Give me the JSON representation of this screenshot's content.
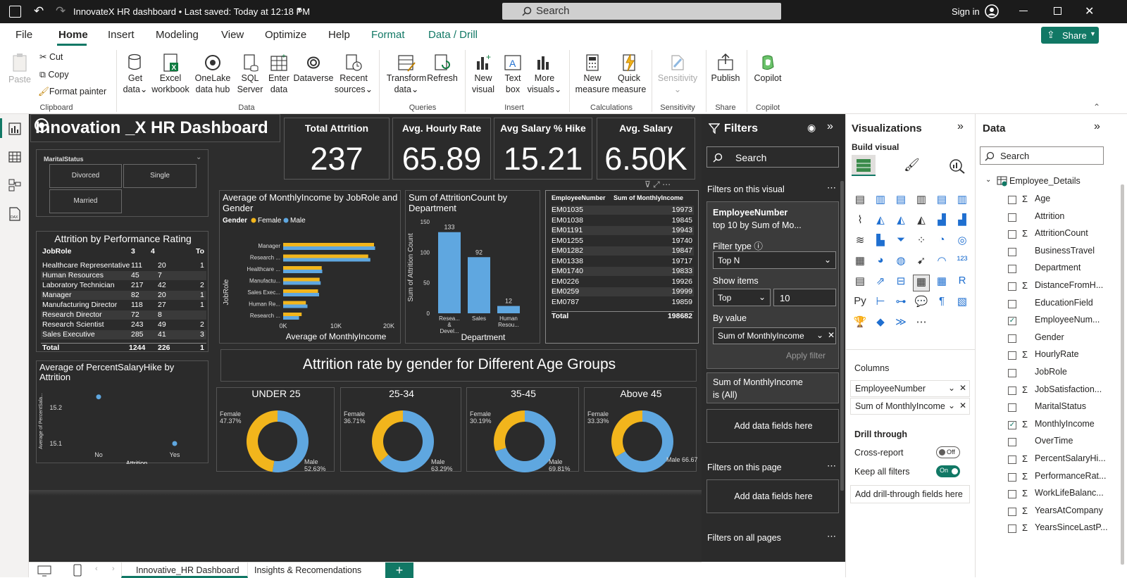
{
  "titlebar": {
    "file_title": "InnovateX HR dashboard • Last saved: Today at 12:18 PM",
    "search": "Search",
    "signin": "Sign in"
  },
  "tabs": [
    "File",
    "Home",
    "Insert",
    "Modeling",
    "View",
    "Optimize",
    "Help",
    "Format",
    "Data / Drill"
  ],
  "share": "Share",
  "ribbon": {
    "clipboard": {
      "paste": "Paste",
      "cut": "Cut",
      "copy": "Copy",
      "format_painter": "Format painter",
      "group": "Clipboard"
    },
    "data": {
      "get_data_1": "Get",
      "get_data_2": "data",
      "excel_1": "Excel",
      "excel_2": "workbook",
      "onelake_1": "OneLake",
      "onelake_2": "data hub",
      "sql_1": "SQL",
      "sql_2": "Server",
      "enter_1": "Enter",
      "enter_2": "data",
      "dataverse": "Dataverse",
      "recent_1": "Recent",
      "recent_2": "sources",
      "group": "Data"
    },
    "queries": {
      "transform_1": "Transform",
      "transform_2": "data",
      "refresh": "Refresh",
      "group": "Queries"
    },
    "insert": {
      "new_visual_1": "New",
      "new_visual_2": "visual",
      "textbox_1": "Text",
      "textbox_2": "box",
      "more_1": "More",
      "more_2": "visuals",
      "group": "Insert"
    },
    "calculations": {
      "newm_1": "New",
      "newm_2": "measure",
      "quick_1": "Quick",
      "quick_2": "measure",
      "group": "Calculations"
    },
    "sensitivity": {
      "label": "Sensitivity",
      "group": "Sensitivity"
    },
    "share_grp": {
      "publish": "Publish",
      "group": "Share"
    },
    "copilot_grp": {
      "copilot": "Copilot",
      "group": "Copilot"
    }
  },
  "dashboard": {
    "title": "Innovation _X HR Dashboard",
    "kpis": [
      {
        "title": "Total Attrition",
        "value": "237"
      },
      {
        "title": "Avg. Hourly Rate",
        "value": "65.89"
      },
      {
        "title": "Avg Salary % Hike",
        "value": "15.21"
      },
      {
        "title": "Avg. Salary",
        "value": "6.50K"
      }
    ],
    "slicer": {
      "title": "MaritalStatus",
      "options": [
        "Divorced",
        "Single",
        "Married"
      ]
    },
    "perf_table": {
      "title": "Attrition by Performance Rating",
      "headers": [
        "JobRole",
        "3",
        "4",
        "To"
      ],
      "rows": [
        [
          "Healthcare Representative",
          "111",
          "20",
          "1"
        ],
        [
          "Human Resources",
          "45",
          "7",
          ""
        ],
        [
          "Laboratory Technician",
          "217",
          "42",
          "2"
        ],
        [
          "Manager",
          "82",
          "20",
          "1"
        ],
        [
          "Manufacturing Director",
          "118",
          "27",
          "1"
        ],
        [
          "Research Director",
          "72",
          "8",
          ""
        ],
        [
          "Research Scientist",
          "243",
          "49",
          "2"
        ],
        [
          "Sales Executive",
          "285",
          "41",
          "3"
        ]
      ],
      "total": [
        "Total",
        "1244",
        "226",
        "1"
      ]
    },
    "section_title": "Attrition rate by gender for Different Age Groups",
    "donuts": [
      {
        "title": "UNDER 25",
        "female_label": "Female",
        "female_pct": "47.37%",
        "male_label": "Male",
        "male_pct": "52.63%",
        "female": 47.37
      },
      {
        "title": "25-34",
        "female_label": "Female",
        "female_pct": "36.71%",
        "male_label": "Male",
        "male_pct": "63.29%",
        "female": 36.71
      },
      {
        "title": "35-45",
        "female_label": "Female",
        "female_pct": "30.19%",
        "male_label": "Male",
        "male_pct": "69.81%",
        "female": 30.19
      },
      {
        "title": "Above 45",
        "female_label": "Female",
        "female_pct": "33.33%",
        "male_label": "Male",
        "male_pct": "66.67%",
        "female": 33.33
      }
    ],
    "emp_table": {
      "headers": [
        "EmployeeNumber",
        "Sum of MonthlyIncome"
      ],
      "rows": [
        [
          "EM01035",
          "19973"
        ],
        [
          "EM01038",
          "19845"
        ],
        [
          "EM01191",
          "19943"
        ],
        [
          "EM01255",
          "19740"
        ],
        [
          "EM01282",
          "19847"
        ],
        [
          "EM01338",
          "19717"
        ],
        [
          "EM01740",
          "19833"
        ],
        [
          "EM0226",
          "19926"
        ],
        [
          "EM0259",
          "19999"
        ],
        [
          "EM0787",
          "19859"
        ]
      ],
      "total": [
        "Total",
        "198682"
      ]
    }
  },
  "chart_data": [
    {
      "type": "bar",
      "title": "Average of MonthlyIncome by JobRole and Gender",
      "legend_title": "Gender",
      "xlabel": "Average of MonthlyIncome",
      "ylabel": "JobRole",
      "xticks": [
        "0K",
        "10K",
        "20K"
      ],
      "xlim": [
        0,
        20000
      ],
      "categories": [
        "Manager",
        "Research ...",
        "Healthcare ...",
        "Manufactu...",
        "Sales Exec...",
        "Human Re...",
        "Research ..."
      ],
      "series": [
        {
          "name": "Female",
          "color": "#F2B51C",
          "values": [
            17200,
            16100,
            7300,
            6900,
            6600,
            4300,
            3500
          ]
        },
        {
          "name": "Male",
          "color": "#5FA7E0",
          "values": [
            17400,
            16500,
            7400,
            7100,
            6800,
            4600,
            3000
          ]
        }
      ]
    },
    {
      "type": "bar",
      "title": "Sum of AttritionCount by Department",
      "xlabel": "Department",
      "ylabel": "Sum of Attrition Count",
      "ylim": [
        0,
        150
      ],
      "yticks": [
        "150",
        "100",
        "50",
        "0"
      ],
      "categories": [
        "Resea...\n&\nDevel...",
        "Sales",
        "Human\nResou..."
      ],
      "values": [
        133,
        92,
        12
      ],
      "color": "#5FA7E0"
    },
    {
      "type": "scatter",
      "title": "Average of PercentSalaryHike by Attrition",
      "xlabel": "Attrition",
      "ylabel": "Average of PercentSala...",
      "yticks": [
        "15.2",
        "15.1"
      ],
      "categories": [
        "No",
        "Yes"
      ],
      "values": [
        15.23,
        15.1
      ],
      "color": "#5FA7E0"
    }
  ],
  "filters": {
    "title": "Filters",
    "search": "Search",
    "on_visual": "Filters on this visual",
    "card1": {
      "field": "EmployeeNumber",
      "desc": "top 10 by Sum of Mo...",
      "filter_type_label": "Filter type",
      "filter_type": "Top N",
      "show_items_label": "Show items",
      "show_dir": "Top",
      "show_count": "10",
      "by_value_label": "By value",
      "by_value": "Sum of MonthlyIncome",
      "apply": "Apply filter"
    },
    "card2": {
      "field": "Sum of MonthlyIncome",
      "desc": "is (All)"
    },
    "add_fields": "Add data fields here",
    "on_page": "Filters on this page",
    "add_fields2": "Add data fields here",
    "on_all": "Filters on all pages"
  },
  "viz": {
    "title": "Visualizations",
    "build": "Build visual",
    "columns_label": "Columns",
    "columns": [
      "EmployeeNumber",
      "Sum of MonthlyIncome"
    ],
    "drill": "Drill through",
    "cross": "Cross-report",
    "cross_state": "Off",
    "keep": "Keep all filters",
    "keep_state": "On",
    "add_drill": "Add drill-through fields here"
  },
  "data_pane": {
    "title": "Data",
    "search": "Search",
    "table": "Employee_Details",
    "fields": [
      {
        "name": "Age",
        "sigma": true,
        "checked": false
      },
      {
        "name": "Attrition",
        "sigma": false,
        "checked": false
      },
      {
        "name": "AttritionCount",
        "sigma": true,
        "checked": false
      },
      {
        "name": "BusinessTravel",
        "sigma": false,
        "checked": false
      },
      {
        "name": "Department",
        "sigma": false,
        "checked": false
      },
      {
        "name": "DistanceFromH...",
        "sigma": true,
        "checked": false
      },
      {
        "name": "EducationField",
        "sigma": false,
        "checked": false
      },
      {
        "name": "EmployeeNum...",
        "sigma": false,
        "checked": true
      },
      {
        "name": "Gender",
        "sigma": false,
        "checked": false
      },
      {
        "name": "HourlyRate",
        "sigma": true,
        "checked": false
      },
      {
        "name": "JobRole",
        "sigma": false,
        "checked": false
      },
      {
        "name": "JobSatisfaction...",
        "sigma": true,
        "checked": false
      },
      {
        "name": "MaritalStatus",
        "sigma": false,
        "checked": false
      },
      {
        "name": "MonthlyIncome",
        "sigma": true,
        "checked": true
      },
      {
        "name": "OverTime",
        "sigma": false,
        "checked": false
      },
      {
        "name": "PercentSalaryHi...",
        "sigma": true,
        "checked": false
      },
      {
        "name": "PerformanceRat...",
        "sigma": true,
        "checked": false
      },
      {
        "name": "WorkLifeBalanc...",
        "sigma": true,
        "checked": false
      },
      {
        "name": "YearsAtCompany",
        "sigma": true,
        "checked": false
      },
      {
        "name": "YearsSinceLastP...",
        "sigma": true,
        "checked": false
      }
    ]
  },
  "pages": [
    "Innovative_HR Dashboard",
    "Insights & Recomendations"
  ],
  "colors": {
    "female": "#F2B51C",
    "male": "#5FA7E0",
    "accent": "#117865",
    "canvas": "#2d2d2d"
  }
}
